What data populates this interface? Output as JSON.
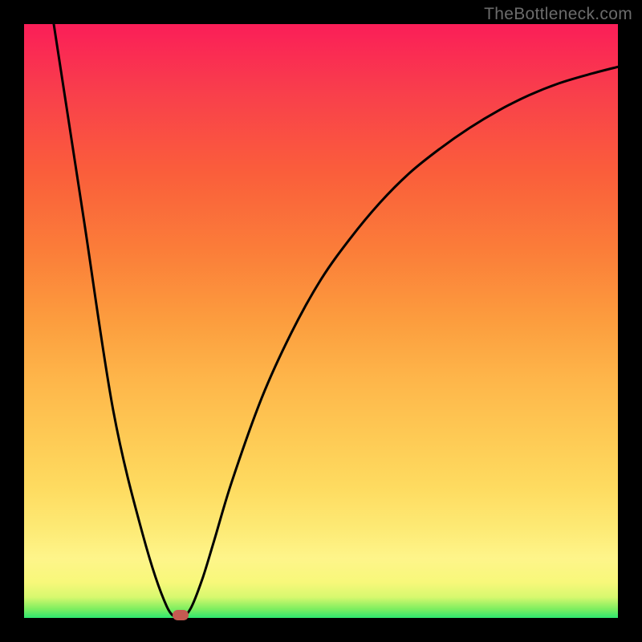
{
  "watermark": "TheBottleneck.com",
  "chart_data": {
    "type": "line",
    "title": "",
    "xlabel": "",
    "ylabel": "",
    "xlim": [
      0,
      100
    ],
    "ylim": [
      0,
      100
    ],
    "grid": false,
    "legend": false,
    "background_style": "vertical gradient: magenta-red (top) through orange and yellow to green (bottom)",
    "series": [
      {
        "name": "curve",
        "stroke": "#000000",
        "points": [
          {
            "x": 5.0,
            "y": 100.0
          },
          {
            "x": 10.0,
            "y": 67.5
          },
          {
            "x": 15.0,
            "y": 35.0
          },
          {
            "x": 20.0,
            "y": 14.0
          },
          {
            "x": 24.0,
            "y": 2.0
          },
          {
            "x": 26.3,
            "y": 0.2
          },
          {
            "x": 28.0,
            "y": 1.5
          },
          {
            "x": 30.0,
            "y": 6.5
          },
          {
            "x": 32.0,
            "y": 13.0
          },
          {
            "x": 35.0,
            "y": 23.0
          },
          {
            "x": 40.0,
            "y": 37.0
          },
          {
            "x": 45.0,
            "y": 48.0
          },
          {
            "x": 50.0,
            "y": 57.0
          },
          {
            "x": 55.0,
            "y": 64.0
          },
          {
            "x": 60.0,
            "y": 70.0
          },
          {
            "x": 65.0,
            "y": 75.0
          },
          {
            "x": 70.0,
            "y": 79.0
          },
          {
            "x": 75.0,
            "y": 82.5
          },
          {
            "x": 80.0,
            "y": 85.5
          },
          {
            "x": 85.0,
            "y": 88.0
          },
          {
            "x": 90.0,
            "y": 90.0
          },
          {
            "x": 95.0,
            "y": 91.5
          },
          {
            "x": 100.0,
            "y": 92.8
          }
        ]
      }
    ],
    "marker": {
      "name": "minimum-marker",
      "color": "#c45a51",
      "x": 26.3,
      "y": 0.5
    }
  }
}
